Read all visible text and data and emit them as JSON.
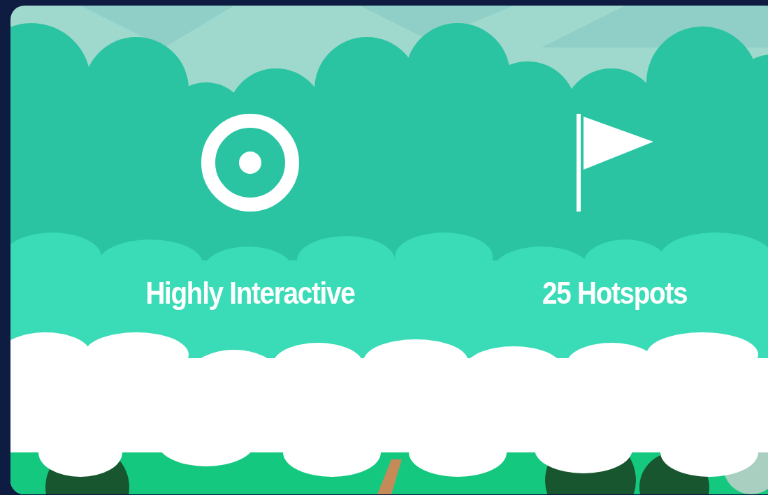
{
  "features": [
    {
      "kind": "target",
      "label": "Highly Interactive"
    },
    {
      "kind": "flag",
      "label": "25 Hotspots"
    }
  ]
}
